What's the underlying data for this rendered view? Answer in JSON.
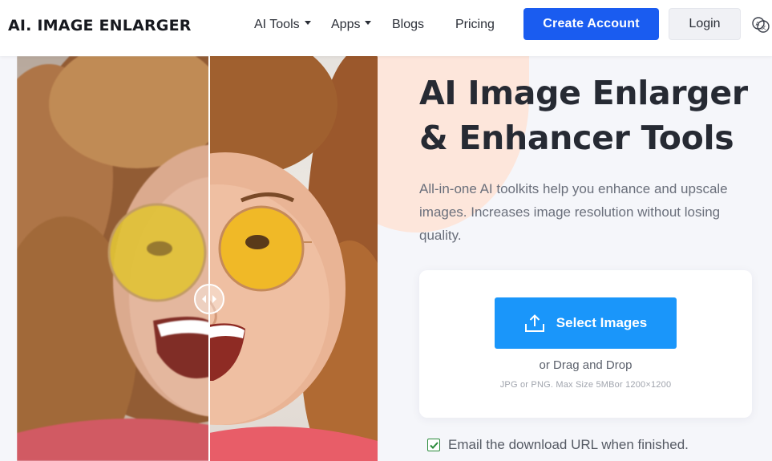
{
  "header": {
    "logo": "AI. IMAGE ENLARGER",
    "nav": [
      {
        "label": "AI Tools",
        "dropdown": true
      },
      {
        "label": "Apps",
        "dropdown": true
      },
      {
        "label": "Blogs",
        "dropdown": false
      },
      {
        "label": "Pricing",
        "dropdown": false
      }
    ],
    "create_account": "Create Account",
    "login": "Login",
    "language_icon": "translate-icon"
  },
  "hero": {
    "title_line1": "AI Image Enlarger",
    "title_line2": "& Enhancer Tools",
    "description": "All-in-one AI toolkits help you enhance and upscale images. Increases image resolution without losing quality."
  },
  "upload": {
    "select_label": "Select Images",
    "upload_icon": "upload-icon",
    "drag_text": "or Drag and Drop",
    "limits": "JPG or PNG. Max Size 5MBor 1200×1200"
  },
  "email_option": {
    "label": "Email the download URL when finished.",
    "checked": true
  },
  "colors": {
    "primary_button": "#1a5cf0",
    "select_button": "#1a96fa",
    "blob": "#fde6db",
    "checkbox": "#2a8a3a"
  }
}
